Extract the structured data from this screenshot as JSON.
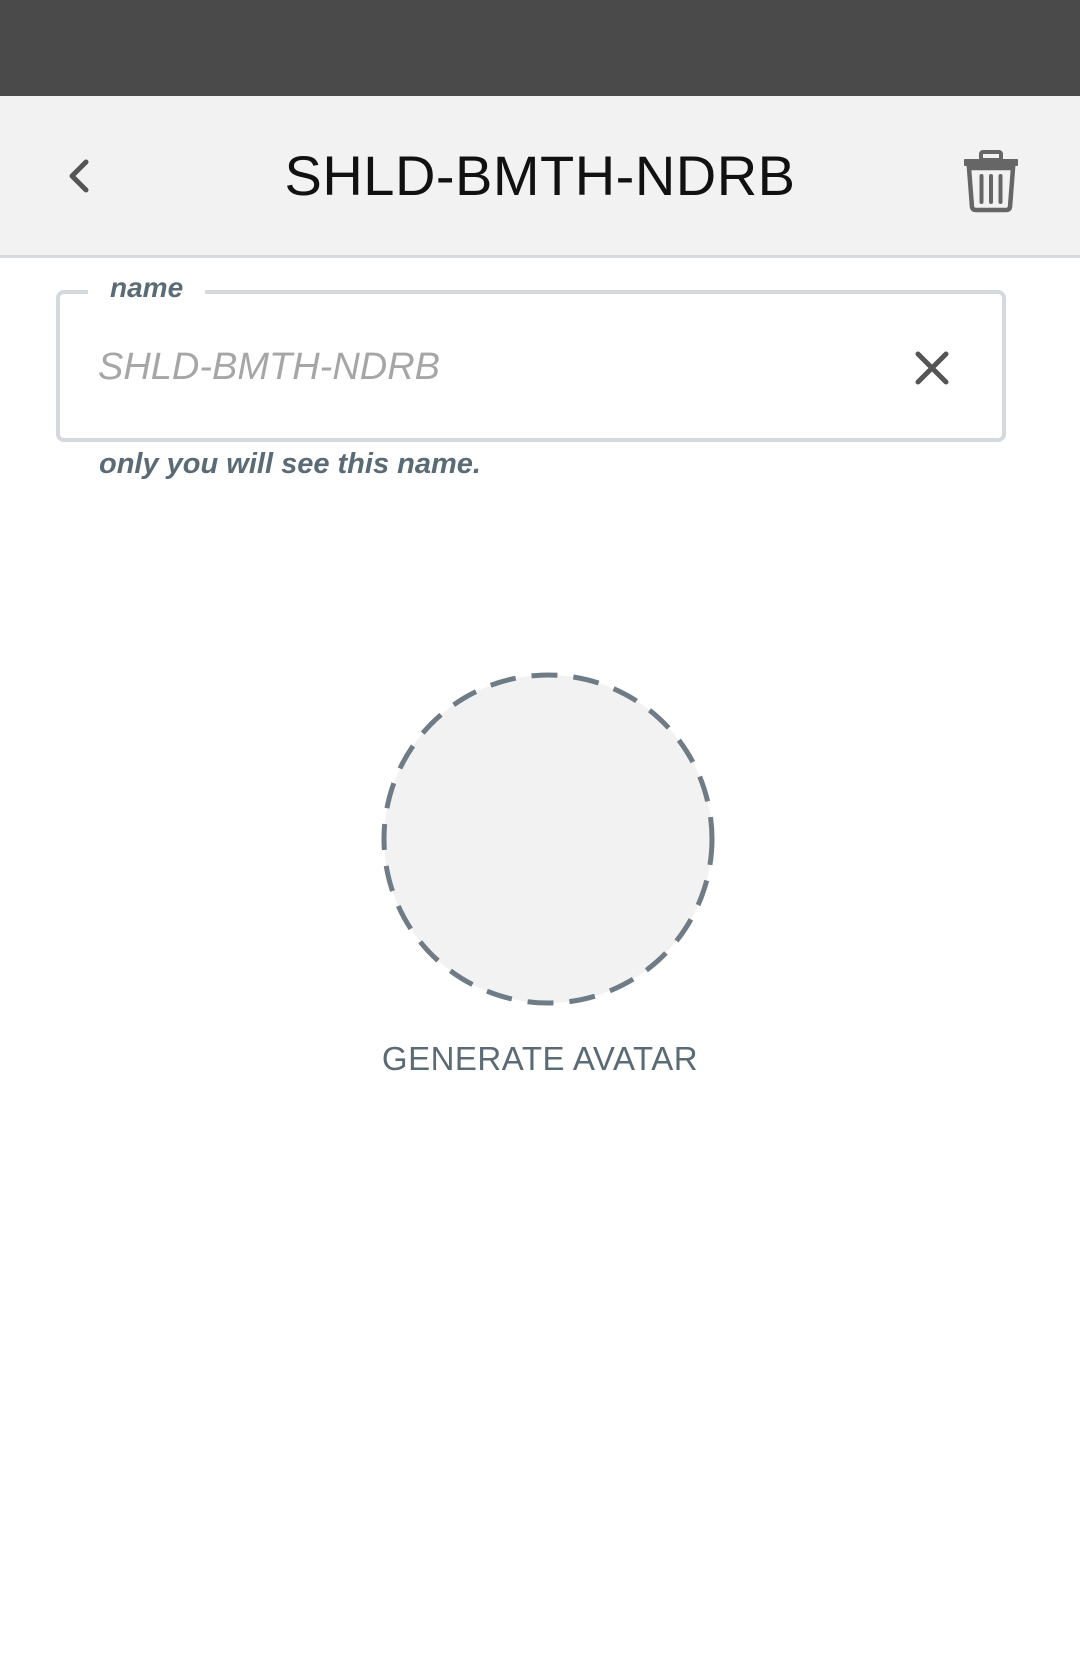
{
  "app_bar": {
    "title": "SHLD-BMTH-NDRB",
    "back_icon": "chevron-left-icon",
    "delete_icon": "trash-icon"
  },
  "name_field": {
    "label": "name",
    "value": "",
    "placeholder": "SHLD-BMTH-NDRB",
    "clear_icon": "close-icon",
    "helper_text": "only you will see this name."
  },
  "avatar": {
    "action_label": "GENERATE AVATAR"
  },
  "colors": {
    "status_bar": "#4a4a4a",
    "app_bar": "#f2f2f2",
    "muted_text": "#5a6b76",
    "avatar_fill": "#f2f2f2",
    "avatar_border": "#6f7c86"
  }
}
